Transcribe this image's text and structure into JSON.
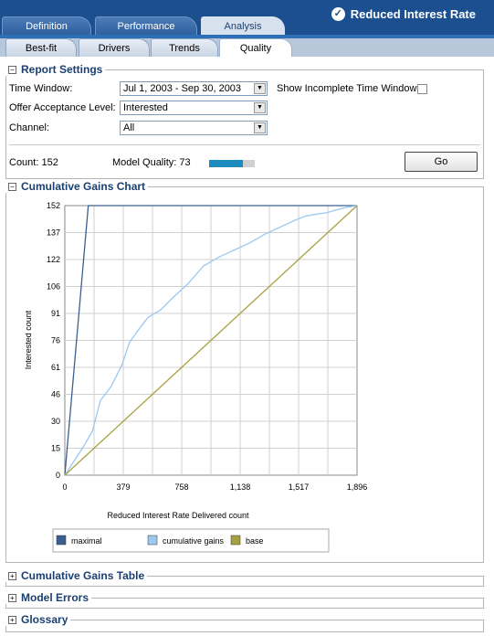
{
  "header": {
    "tabs": [
      {
        "label": "Definition",
        "active": false
      },
      {
        "label": "Performance",
        "active": false
      },
      {
        "label": "Analysis",
        "active": true
      }
    ],
    "title": "Reduced Interest Rate"
  },
  "subtabs": [
    {
      "label": "Best-fit",
      "active": false
    },
    {
      "label": "Drivers",
      "active": false
    },
    {
      "label": "Trends",
      "active": false
    },
    {
      "label": "Quality",
      "active": true
    }
  ],
  "report_settings": {
    "title": "Report Settings",
    "time_window_label": "Time Window:",
    "time_window_value": "Jul 1, 2003 - Sep 30, 2003",
    "show_incomplete_label": "Show Incomplete Time Window:",
    "show_incomplete_checked": false,
    "offer_label": "Offer Acceptance Level:",
    "offer_value": "Interested",
    "channel_label": "Channel:",
    "channel_value": "All",
    "count_text": "Count: 152",
    "model_quality_text": "Model Quality: 73",
    "model_quality_value": 73,
    "go_label": "Go"
  },
  "chart_section": {
    "title": "Cumulative Gains Chart"
  },
  "chart_data": {
    "type": "line",
    "xlabel": "Reduced Interest Rate Delivered count",
    "ylabel": "Interested count",
    "xlim": [
      0,
      1896
    ],
    "ylim": [
      0,
      152
    ],
    "x_ticks": [
      "0",
      "379",
      "758",
      "1,138",
      "1,517",
      "1,896"
    ],
    "y_ticks": [
      "0",
      "15",
      "30",
      "46",
      "61",
      "76",
      "91",
      "106",
      "122",
      "137",
      "152"
    ],
    "grid": true,
    "legend_position": "bottom",
    "series": [
      {
        "name": "maximal",
        "color": "#3a5f8f",
        "x": [
          0,
          152,
          1896
        ],
        "y": [
          0,
          152,
          152
        ]
      },
      {
        "name": "cumulative gains",
        "color": "#9cc8f0",
        "x": [
          0,
          60,
          120,
          180,
          230,
          300,
          370,
          420,
          470,
          540,
          620,
          700,
          800,
          900,
          1000,
          1100,
          1200,
          1300,
          1400,
          1500,
          1560,
          1620,
          1700,
          1780,
          1830,
          1896
        ],
        "y": [
          0,
          8,
          16,
          25,
          42,
          50,
          62,
          75,
          81,
          89,
          93,
          100,
          108,
          118,
          123,
          127,
          131,
          136,
          140,
          144,
          146,
          147,
          148,
          150,
          151,
          152
        ]
      },
      {
        "name": "base",
        "color": "#a8a040",
        "x": [
          0,
          1896
        ],
        "y": [
          0,
          152
        ]
      }
    ]
  },
  "collapsed_sections": [
    {
      "title": "Cumulative Gains Table"
    },
    {
      "title": "Model Errors"
    },
    {
      "title": "Glossary"
    }
  ]
}
